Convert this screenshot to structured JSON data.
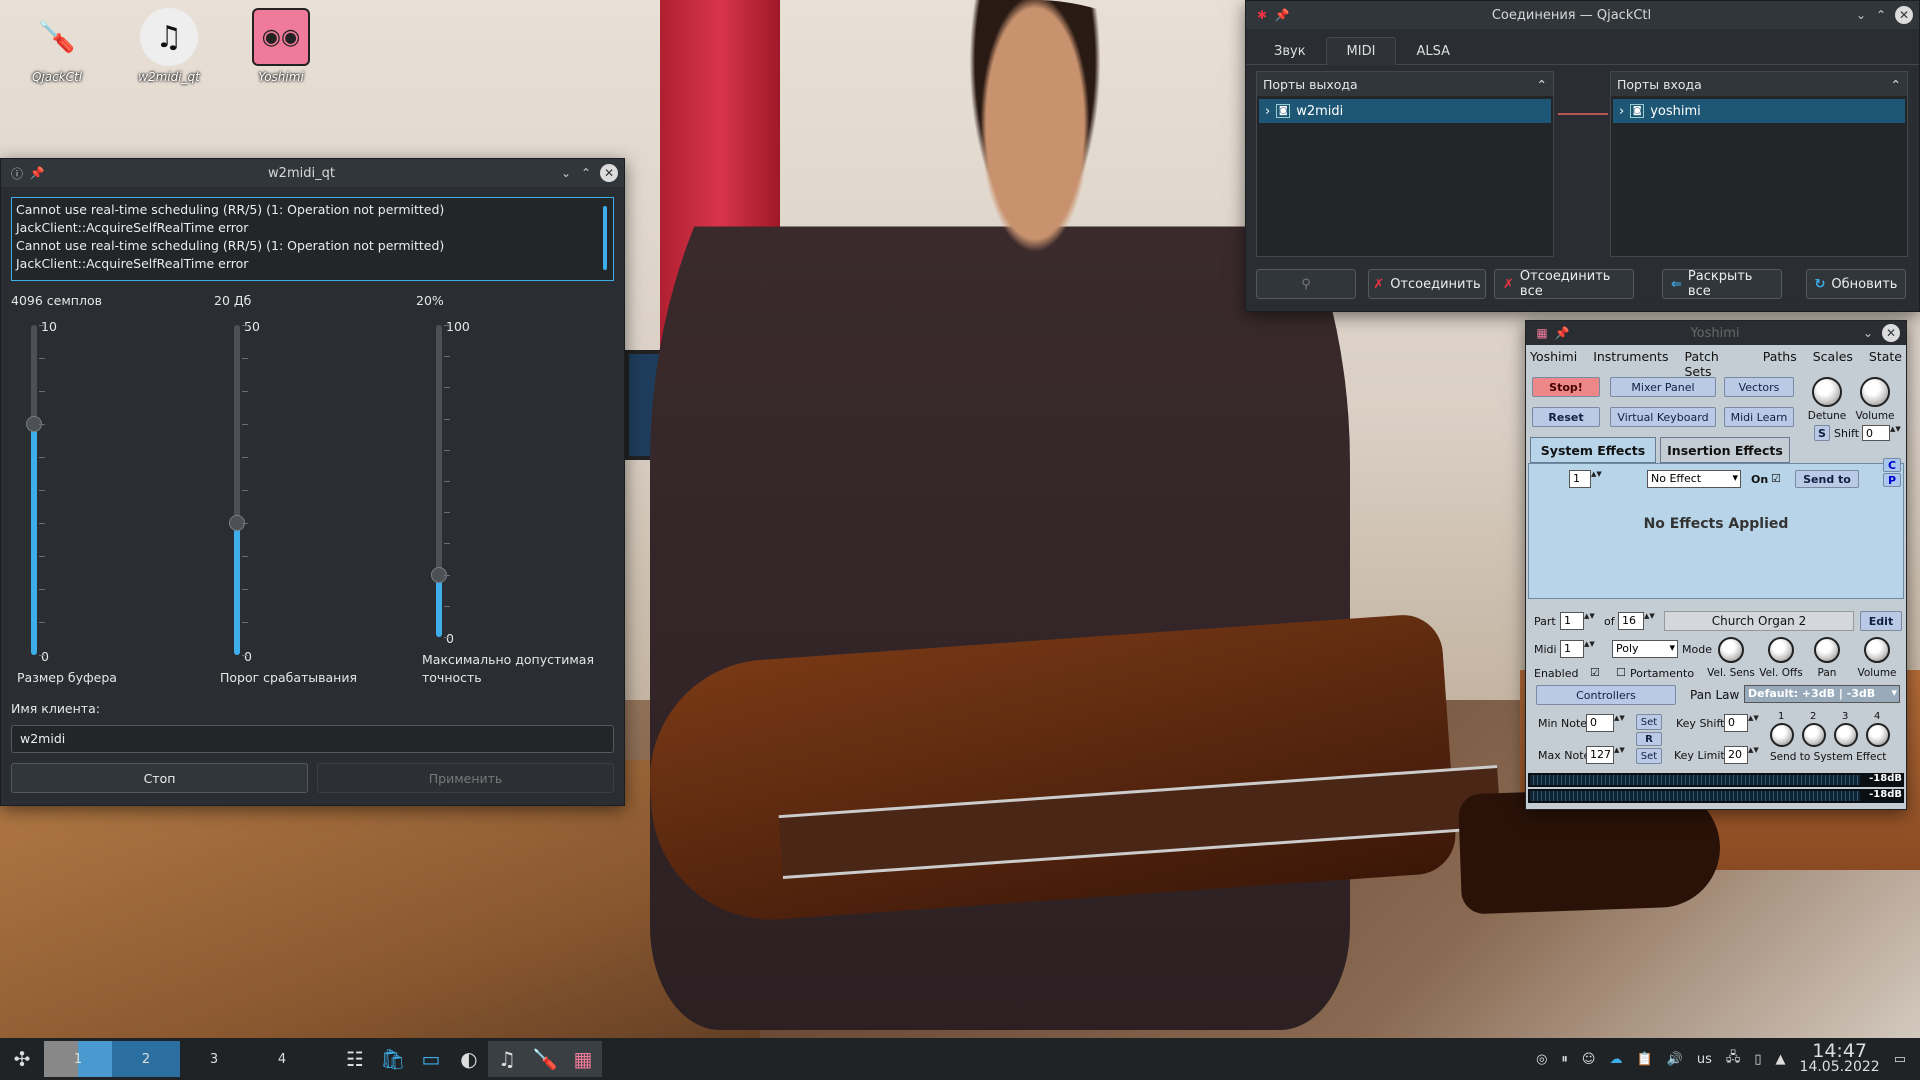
{
  "desktop_icons": [
    {
      "label": "QjackCtl",
      "icon": "screwdriver-icon"
    },
    {
      "label": "w2midi_qt",
      "icon": "music-disc-icon"
    },
    {
      "label": "Yoshimi",
      "icon": "yoshimi-robot-icon"
    }
  ],
  "w2midi": {
    "title": "w2midi_qt",
    "log": [
      "Cannot use real-time scheduling (RR/5) (1: Operation not permitted)",
      "JackClient::AcquireSelfRealTime error",
      "Cannot use real-time scheduling (RR/5) (1: Operation not permitted)",
      "JackClient::AcquireSelfRealTime error"
    ],
    "sliders": [
      {
        "value": "4096 семплов",
        "max": "10",
        "min": "0",
        "name": "Размер буфера",
        "level": 0.7
      },
      {
        "value": "20 Дб",
        "max": "50",
        "min": "0",
        "name": "Порог срабатывания",
        "level": 0.4
      },
      {
        "value": "20%",
        "max": "100",
        "min": "0",
        "name": "Максимально допустимая точность",
        "level": 0.2
      }
    ],
    "client_label": "Имя клиента:",
    "client_value": "w2midi",
    "stop_button": "Стоп",
    "apply_button": "Применить"
  },
  "qjackctl": {
    "title": "Соединения — QjackCtl",
    "tabs": [
      "Звук",
      "MIDI",
      "ALSA"
    ],
    "active_tab": "MIDI",
    "output_ports_label": "Порты выхода",
    "input_ports_label": "Порты входа",
    "output_client": "w2midi",
    "input_client": "yoshimi",
    "buttons": {
      "disconnect": "Отсоединить",
      "disconnect_all": "Отсоединить все",
      "expand_all": "Раскрыть все",
      "refresh": "Обновить"
    }
  },
  "yoshimi": {
    "title": "Yoshimi",
    "menu": [
      "Yoshimi",
      "Instruments",
      "Patch Sets",
      "Paths",
      "Scales",
      "State"
    ],
    "buttons": {
      "stop": "Stop!",
      "reset": "Reset",
      "mixer_panel": "Mixer Panel",
      "virtual_keyboard": "Virtual Keyboard",
      "vectors": "Vectors",
      "midi_learn": "Midi Learn",
      "send_to": "Send to",
      "edit": "Edit",
      "controllers": "Controllers",
      "set": "Set",
      "r": "R",
      "s": "S",
      "c": "C",
      "p": "P"
    },
    "knobs": {
      "detune": "Detune",
      "volume": "Volume",
      "vel_sens": "Vel. Sens",
      "vel_offs": "Vel. Offs",
      "pan": "Pan"
    },
    "shift_label": "Shift",
    "shift_value": "0",
    "tabs": {
      "system_effects": "System Effects",
      "insertion_effects": "Insertion Effects"
    },
    "effect_number": "1",
    "effect_select": "No Effect",
    "on_label": "On",
    "no_effects_text": "No Effects Applied",
    "part_label": "Part",
    "part_value": "1",
    "of_label": "of",
    "of_value": "16",
    "instrument_name": "Church Organ 2",
    "midi_label": "Midi",
    "midi_value": "1",
    "mode_select": "Poly",
    "mode_label": "Mode",
    "enabled_label": "Enabled",
    "portamento_label": "Portamento",
    "pan_law_label": "Pan Law",
    "pan_law_value": "Default: +3dB | -3dB",
    "min_note_label": "Min Note",
    "min_note_value": "0",
    "max_note_label": "Max Note",
    "max_note_value": "127",
    "key_shift_label": "Key Shift",
    "key_shift_value": "0",
    "key_limit_label": "Key Limit",
    "key_limit_value": "20",
    "send_numbers": [
      "1",
      "2",
      "3",
      "4"
    ],
    "send_to_system": "Send to System Effect",
    "meter_db": [
      "-18dB",
      "-18dB"
    ]
  },
  "taskbar": {
    "workspaces": [
      "1",
      "2",
      "3",
      "4"
    ],
    "keyboard_layout": "us",
    "time": "14:47",
    "date": "14.05.2022"
  }
}
